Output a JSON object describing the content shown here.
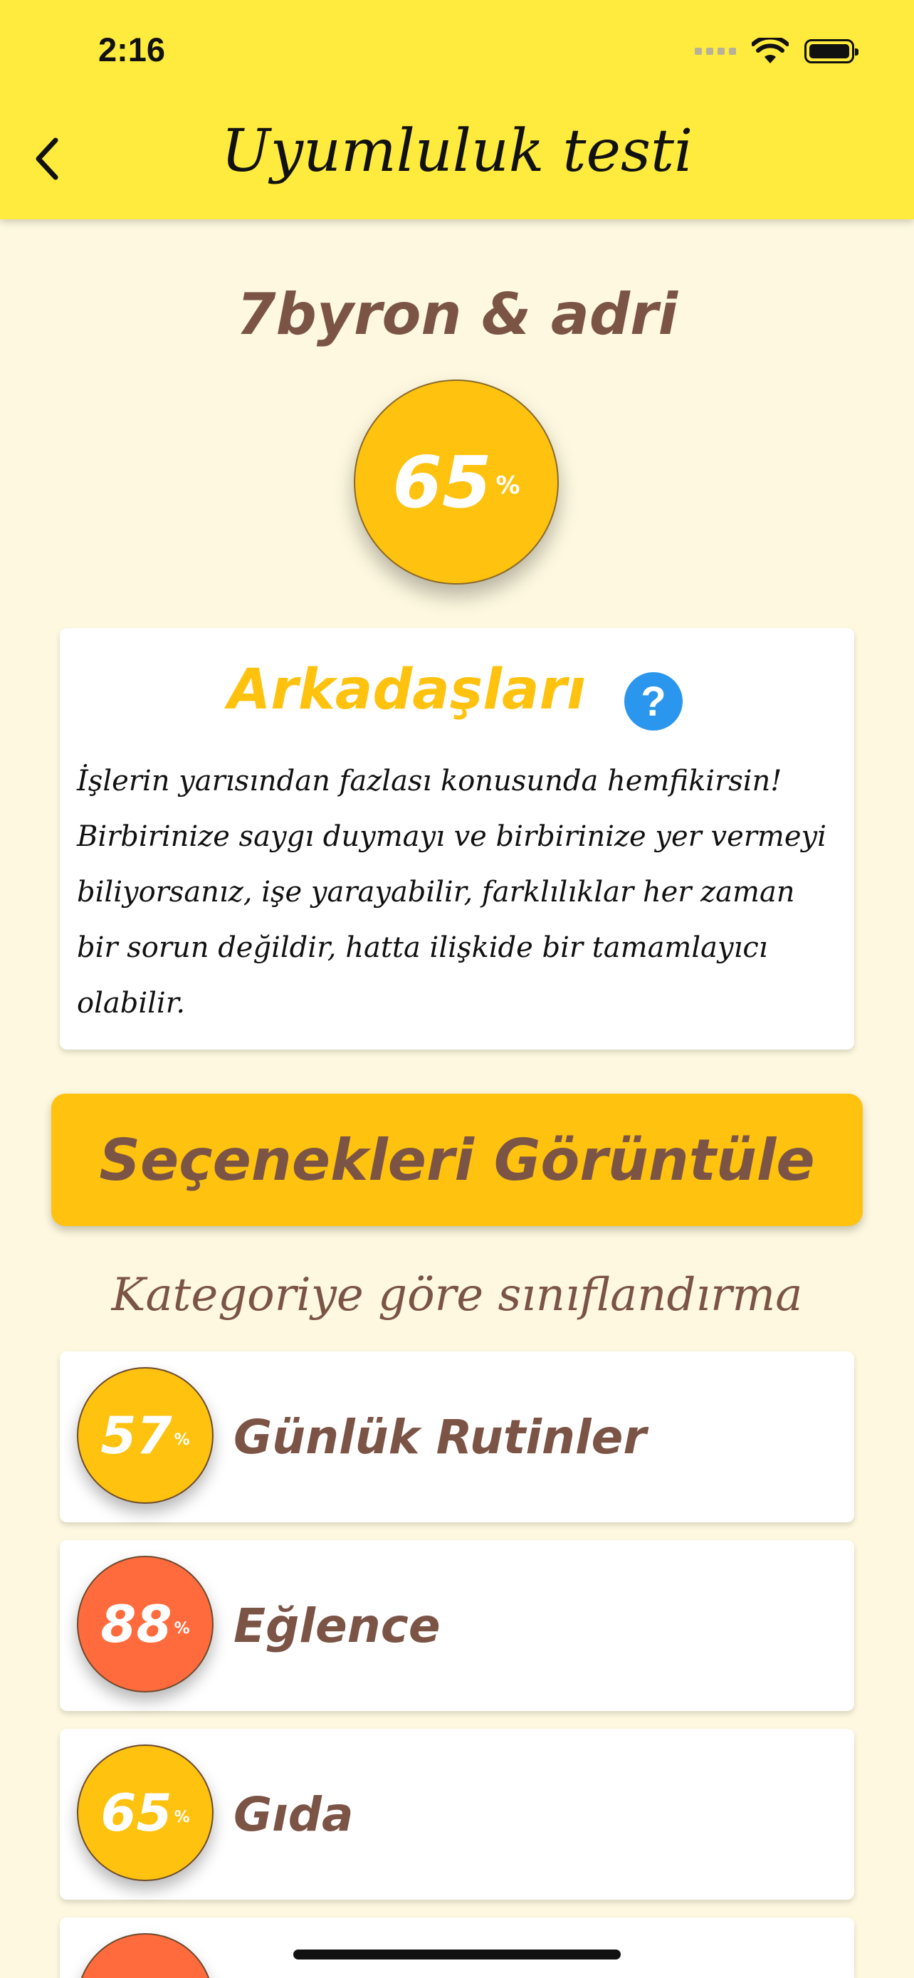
{
  "status_bar": {
    "time": "2:16"
  },
  "nav": {
    "title": "Uyumluluk testi",
    "back_icon": "chevron-left-icon"
  },
  "header": {
    "names": "7byron & adri",
    "score": "65",
    "score_unit": "%"
  },
  "result": {
    "title": "Arkadaşları",
    "help_icon_label": "?",
    "lines": [
      "İşlerin yarısından fazlası konusunda hemfikirsin!",
      "Birbirinize saygı duymayı ve birbirinize yer vermeyi",
      "biliyorsanız, işe yarayabilir, farklılıklar her zaman",
      "bir sorun değildir, hatta ilişkide bir tamamlayıcı",
      "olabilir."
    ]
  },
  "cta_label": "Seçenekleri Görüntüle",
  "section_title": "Kategoriye göre sınıflandırma",
  "categories": [
    {
      "score": "57",
      "unit": "%",
      "name": "Günlük Rutinler",
      "color": "#fec20f"
    },
    {
      "score": "88",
      "unit": "%",
      "name": "Eğlence",
      "color": "#ff6b3d"
    },
    {
      "score": "65",
      "unit": "%",
      "name": "Gıda",
      "color": "#fec20f"
    },
    {
      "score": "",
      "unit": "",
      "name": "",
      "color": "#ff6b3d"
    }
  ],
  "colors": {
    "accent": "#fec20f",
    "header": "#feeb3d",
    "text_brown": "#7b5446",
    "help_blue": "#2b96ee",
    "hot": "#ff6b3d"
  }
}
